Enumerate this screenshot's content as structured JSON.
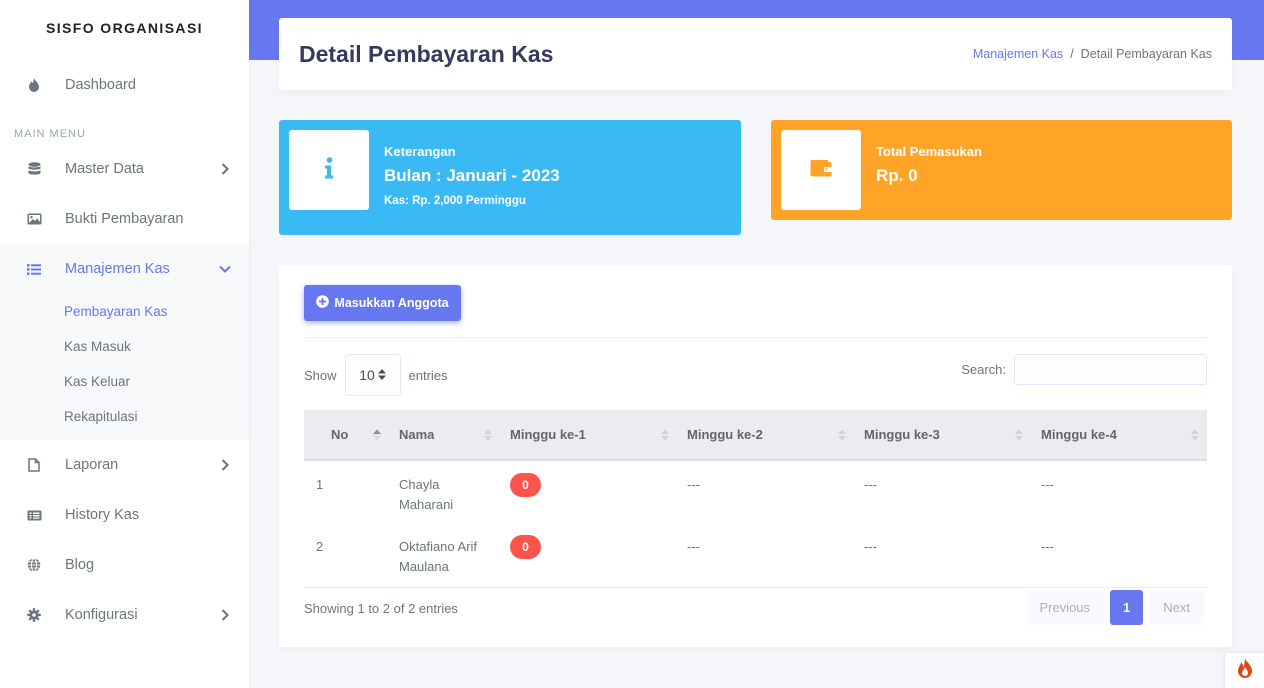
{
  "sidebar": {
    "brand": "SISFO ORGANISASI",
    "dashboard": "Dashboard",
    "menu_header": "MAIN MENU",
    "items": [
      {
        "label": "Master Data"
      },
      {
        "label": "Bukti Pembayaran"
      },
      {
        "label": "Manajemen Kas"
      },
      {
        "label": "Laporan"
      },
      {
        "label": "History Kas"
      },
      {
        "label": "Blog"
      },
      {
        "label": "Konfigurasi"
      }
    ],
    "submenu": [
      {
        "label": "Pembayaran Kas"
      },
      {
        "label": "Kas Masuk"
      },
      {
        "label": "Kas Keluar"
      },
      {
        "label": "Rekapitulasi"
      }
    ]
  },
  "header": {
    "title": "Detail Pembayaran Kas",
    "breadcrumb": [
      "Manajemen Kas",
      "/",
      "Detail Pembayaran Kas"
    ]
  },
  "cards": {
    "info": {
      "label": "Keterangan",
      "value": "Bulan : Januari - 2023",
      "note": "Kas: Rp. 2,000 Perminggu"
    },
    "income": {
      "label": "Total Pemasukan",
      "value": "Rp. 0"
    }
  },
  "toolbar": {
    "add_label": "Masukkan Anggota",
    "show_label": "Show",
    "entries_value": "10",
    "entries_label": "entries",
    "search_label": "Search:",
    "search_value": ""
  },
  "table": {
    "columns": [
      "No",
      "Nama",
      "Minggu ke-1",
      "Minggu ke-2",
      "Minggu ke-3",
      "Minggu ke-4"
    ],
    "rows": [
      {
        "no": "1",
        "nama": "Chayla Maharani",
        "m1": "0",
        "m2": "---",
        "m3": "---",
        "m4": "---"
      },
      {
        "no": "2",
        "nama": "Oktafiano Arif Maulana",
        "m1": "0",
        "m2": "---",
        "m3": "---",
        "m4": "---"
      }
    ]
  },
  "footer": {
    "info": "Showing 1 to 2 of 2 entries",
    "previous": "Previous",
    "page": "1",
    "next": "Next"
  },
  "colors": {
    "primary": "#6777ef",
    "info": "#3abaf4",
    "warning": "#ffa426",
    "danger": "#fc544b"
  }
}
